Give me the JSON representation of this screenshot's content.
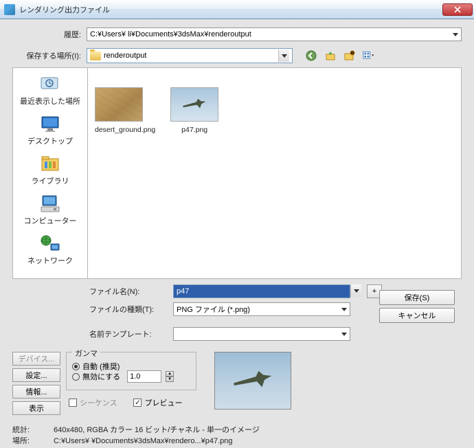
{
  "title": "レンダリング出力ファイル",
  "history": {
    "label": "履歴:",
    "value": "C:¥Users¥                               li¥Documents¥3dsMax¥renderoutput"
  },
  "savein": {
    "label": "保存する場所(I):",
    "value": "renderoutput"
  },
  "places": {
    "recent": "最近表示した場所",
    "desktop": "デスクトップ",
    "library": "ライブラリ",
    "computer": "コンピューター",
    "network": "ネットワーク"
  },
  "files": [
    {
      "name": "desert_ground.png"
    },
    {
      "name": "p47.png"
    }
  ],
  "form": {
    "filename_label": "ファイル名(N):",
    "filename_value": "p47",
    "filetype_label": "ファイルの種類(T):",
    "filetype_value": "PNG ファイル (*.png)",
    "template_label": "名前テンプレート:",
    "template_value": ""
  },
  "buttons": {
    "save": "保存(S)",
    "cancel": "キャンセル",
    "device": "デバイス...",
    "settings": "設定...",
    "info": "情報...",
    "view": "表示",
    "plus": "+"
  },
  "gamma": {
    "title": "ガンマ",
    "auto": "自動 (推奨)",
    "disable": "無効にする",
    "value": "1.0"
  },
  "checks": {
    "sequence": "シーケンス",
    "preview": "プレビュー"
  },
  "stats": {
    "stats_label": "統計:",
    "stats_value": "640x480, RGBA カラー 16 ビット/チャネル - 単一のイメージ",
    "loc_label": "場所:",
    "loc_value": "C:¥Users¥                                ¥Documents¥3dsMax¥rendero...¥p47.png"
  }
}
